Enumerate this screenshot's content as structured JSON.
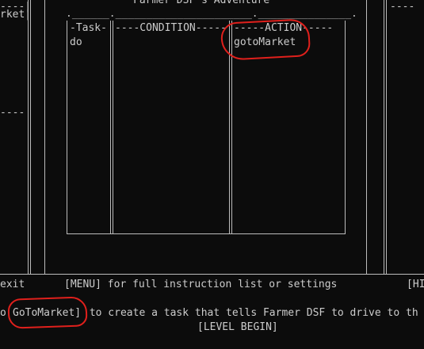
{
  "game": {
    "title": "Farmer DSF's Adventure"
  },
  "left_panel": {
    "dashes_top": "----|",
    "item": "rket|",
    "dashes_mid": "----"
  },
  "right_panel": {
    "dashes_top": "----"
  },
  "table": {
    "top_border": ".______.______________________._______________.",
    "headers": {
      "task": "-Task-",
      "condition": "----CONDITION-----",
      "action": "-----ACTION-----"
    },
    "rows": [
      {
        "task": "do",
        "condition": "",
        "action": "gotoMarket"
      }
    ]
  },
  "instructions": {
    "exit_fragment": "exit",
    "menu_line": "[MENU] for full instruction list or settings",
    "hint_fragment": "[HI",
    "task_line_prefix": "o ",
    "task_line_command": "GoToMarket]",
    "task_line_rest": " to create a task that tells Farmer DSF to drive to th",
    "level_begin": "[LEVEL BEGIN]"
  },
  "annotations": {
    "circle_color": "#e0201c"
  }
}
